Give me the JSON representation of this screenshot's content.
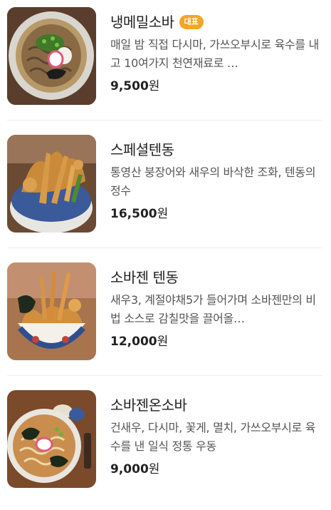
{
  "menu": {
    "items": [
      {
        "name": "냉메밀소바",
        "badge": "대표",
        "description": "매일 밤 직접 다시마, 가쓰오부시로 육수를 내고 10여가지 천연재료로 …",
        "price_number": "9,500",
        "price_unit": "원"
      },
      {
        "name": "스페셜텐동",
        "badge": "",
        "description": "통영산 붕장어와 새우의 바삭한 조화, 텐동의 정수",
        "price_number": "16,500",
        "price_unit": "원"
      },
      {
        "name": "소바젠 텐동",
        "badge": "",
        "description": "새우3, 계절야채5가 들어가며 소바젠만의 비법 소스로 감칠맛을 끌어올…",
        "price_number": "12,000",
        "price_unit": "원"
      },
      {
        "name": "소바젠온소바",
        "badge": "",
        "description": "건새우, 다시마, 꽃게, 멸치, 가쓰오부시로 육수를 낸 일식 정통 우동",
        "price_number": "9,000",
        "price_unit": "원"
      }
    ]
  },
  "colors": {
    "badge": "#f5a623",
    "title": "#222222",
    "description": "#555555",
    "divider": "#eeeeee"
  }
}
